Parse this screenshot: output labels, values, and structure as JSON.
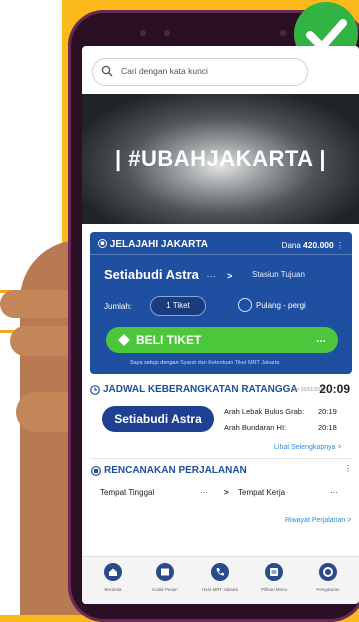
{
  "search": {
    "placeholder": "Cari dengan kata kunci"
  },
  "banner": {
    "title": "| #UBAHJAKARTA |"
  },
  "explore": {
    "header": "JELAJAHI JAKARTA",
    "balance_label": "Dana",
    "balance_value": "420.000",
    "from_station": "Setiabudi Astra",
    "dots": "···",
    "arrow": ">",
    "to_placeholder": "Stasiun Tujuan",
    "quantity_label": "Jumlah:",
    "quantity_value": "1 Tiket",
    "roundtrip_label": "Pulang - pergi",
    "buy_label": "BELI TIKET",
    "buy_more": "...",
    "tnc_prefix": "Saya setuju dengan",
    "tnc_link": "Syarat dan Ketentuan Tiket MRT Jakarta"
  },
  "schedule": {
    "title": "JADWAL KEBERANGKATAN RATANGGA",
    "last_update": "per 15/01/2019",
    "current_time": "20:09",
    "station": "Setiabudi Astra",
    "rows": [
      {
        "dest": "Arah Lebak Bulus Grab:",
        "time": "20:19"
      },
      {
        "dest": "Arah Bundaran HI:",
        "time": "20:18"
      }
    ],
    "see_more": "Lihat Selengkapnya >"
  },
  "planner": {
    "title": "RENCANAKAN PERJALANAN",
    "origin": "Tempat Tinggal",
    "dots": "···",
    "arrow": ">",
    "destination": "Tempat Kerja",
    "history": "Riwayat Perjalanan >"
  },
  "nav": [
    {
      "label": "Beranda"
    },
    {
      "label": "Kotak Pesan"
    },
    {
      "label": "Halo MRT Jakarta"
    },
    {
      "label": "Pilihan Menu"
    },
    {
      "label": "Pengaturan"
    }
  ],
  "colors": {
    "primary": "#1f4fa0",
    "accent_green": "#4cc63a",
    "background": "#fbb91b"
  }
}
